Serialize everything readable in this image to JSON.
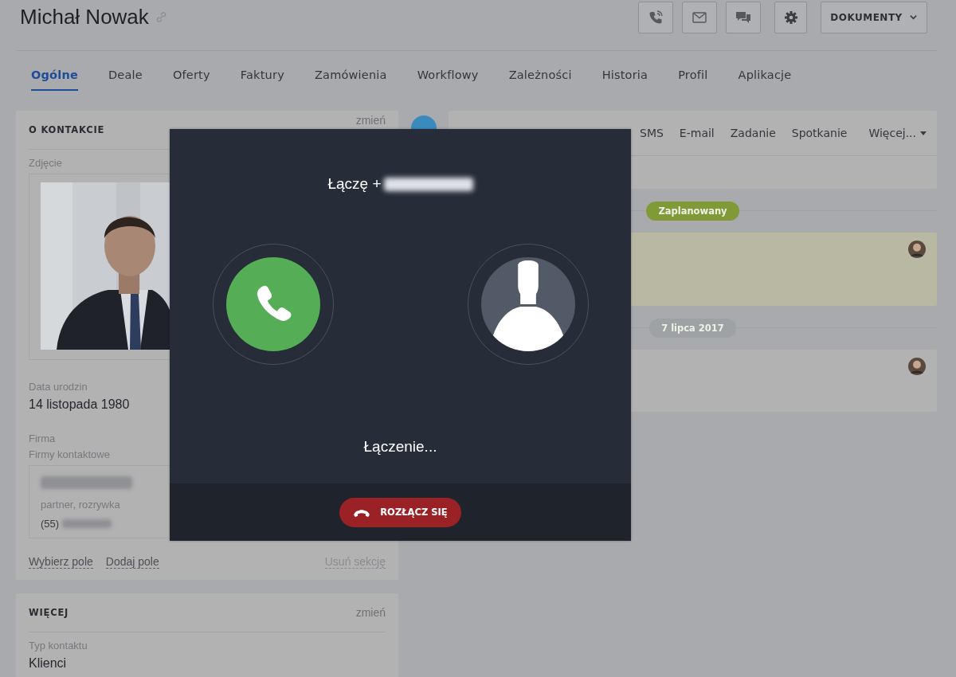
{
  "header": {
    "title": "Michał Nowak",
    "actions": [
      {
        "kind": "phone"
      },
      {
        "kind": "mail"
      },
      {
        "kind": "chat"
      },
      {
        "kind": "settings"
      }
    ],
    "documents_button": "DOKUMENTY"
  },
  "tabs": [
    {
      "label": "Ogólne",
      "selected": true
    },
    {
      "label": "Deale",
      "selected": false
    },
    {
      "label": "Oferty",
      "selected": false
    },
    {
      "label": "Faktury",
      "selected": false
    },
    {
      "label": "Zamówienia",
      "selected": false
    },
    {
      "label": "Workflowy",
      "selected": false
    },
    {
      "label": "Zależności",
      "selected": false
    },
    {
      "label": "Historia",
      "selected": false
    },
    {
      "label": "Profil",
      "selected": false
    },
    {
      "label": "Aplikacje",
      "selected": false
    }
  ],
  "contact_card": {
    "title": "O KONTAKCIE",
    "edit_link": "zmień",
    "photo_label": "Zdjęcie",
    "birth_label": "Data urodzin",
    "birth_value": "14 listopada 1980",
    "company_label": "Firma",
    "companies_label": "Firmy kontaktowe",
    "company": {
      "tags": "partner, rozrywka",
      "phone_prefix": "(55)"
    },
    "links": [
      "Wybierz pole",
      "Dodaj pole"
    ],
    "remove_link": "Usuń sekcję"
  },
  "more_card": {
    "title": "WIĘCEJ",
    "edit_link": "zmień",
    "type_label": "Typ kontaktu",
    "type_value": "Klienci"
  },
  "activity_tabs": {
    "tabs": [
      "SMS",
      "E-mail",
      "Zadanie",
      "Spotkanie"
    ],
    "more": "Więcej..."
  },
  "timeline": [
    {
      "kind": "badge",
      "label": "Zaplanowany",
      "color": "#7f9a36"
    },
    {
      "kind": "card",
      "highlighted": true
    },
    {
      "kind": "badge",
      "label": "7 lipca 2017",
      "color": "#9ea2a4"
    },
    {
      "kind": "card",
      "highlighted": false
    }
  ],
  "call_dialog": {
    "calling_label": "Łączę +",
    "status": "Łączenie...",
    "hangup_button": "ROZŁĄCZ SIĘ"
  }
}
